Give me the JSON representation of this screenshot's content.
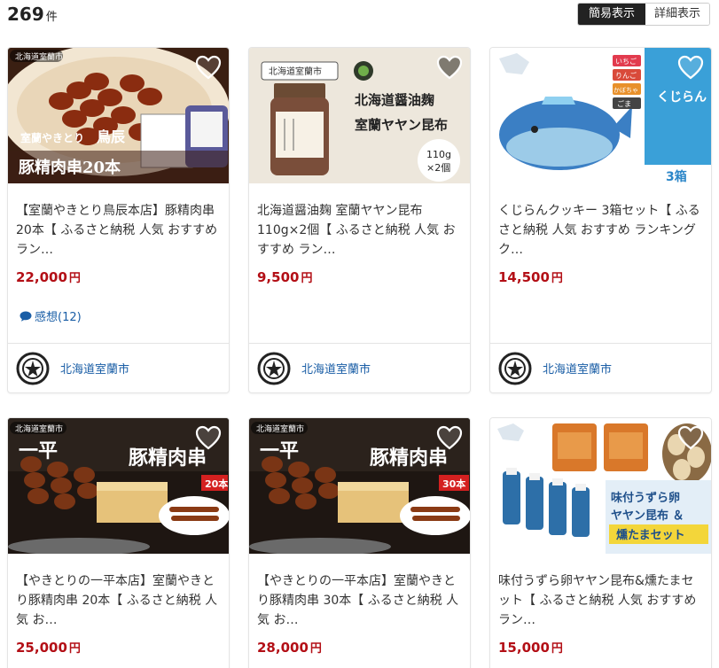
{
  "results": {
    "count": "269",
    "unit": "件"
  },
  "view_toggle": {
    "simple": "簡易表示",
    "detail": "詳細表示"
  },
  "colors": {
    "price": "#b30f16",
    "link": "#1a5ea6",
    "toggle_active": "#222222"
  },
  "cards": [
    {
      "image_text": {
        "region": "北海道室蘭市",
        "brand": "室蘭やきとり",
        "shop": "鳥辰",
        "caption": "豚精肉串20本"
      },
      "title": "【室蘭やきとり鳥辰本店】豚精肉串20本【 ふるさと納税 人気 おすすめ ラン…",
      "price": "22,000",
      "yen": "円",
      "review": "感想(12)",
      "city": "北海道室蘭市"
    },
    {
      "image_text": {
        "region": "北海道室蘭市",
        "line1": "北海道醤油麹",
        "line2": "室蘭ヤヤン昆布",
        "badge1": "110g",
        "badge2": "×2個"
      },
      "title": "北海道醤油麹 室蘭ヤヤン昆布110g×2個【 ふるさと納税 人気 おすすめ ラン…",
      "price": "9,500",
      "yen": "円",
      "city": "北海道室蘭市"
    },
    {
      "image_text": {
        "flavor1": "いちご",
        "flavor2": "りんご",
        "flavor3": "かぼちゃ",
        "flavor4": "ごま",
        "name": "くじらん クッキー",
        "boxes": "3箱"
      },
      "title": "くじらんクッキー 3箱セット【 ふるさと納税 人気 おすすめ ランキング ク…",
      "price": "14,500",
      "yen": "円",
      "city": "北海道室蘭市"
    },
    {
      "image_text": {
        "region": "北海道室蘭市",
        "shop": "一平",
        "caption": "豚精肉串",
        "badge": "20本"
      },
      "title": "【やきとりの一平本店】室蘭やきとり豚精肉串 20本【 ふるさと納税 人気 お…",
      "price": "25,000",
      "yen": "円",
      "city": "北海道室蘭市"
    },
    {
      "image_text": {
        "region": "北海道室蘭市",
        "shop": "一平",
        "caption": "豚精肉串",
        "badge": "30本"
      },
      "title": "【やきとりの一平本店】室蘭やきとり豚精肉串 30本【 ふるさと納税 人気 お…",
      "price": "28,000",
      "yen": "円",
      "city": "北海道室蘭市"
    },
    {
      "image_text": {
        "line1": "味付うずら卵",
        "line2": "ヤヤン昆布 ＆",
        "line3": "燻たまセット"
      },
      "title": "味付うずら卵ヤヤン昆布&燻たまセット【 ふるさと納税 人気 おすすめ ラン…",
      "price": "15,000",
      "yen": "円",
      "city": "北海道室蘭市"
    }
  ]
}
